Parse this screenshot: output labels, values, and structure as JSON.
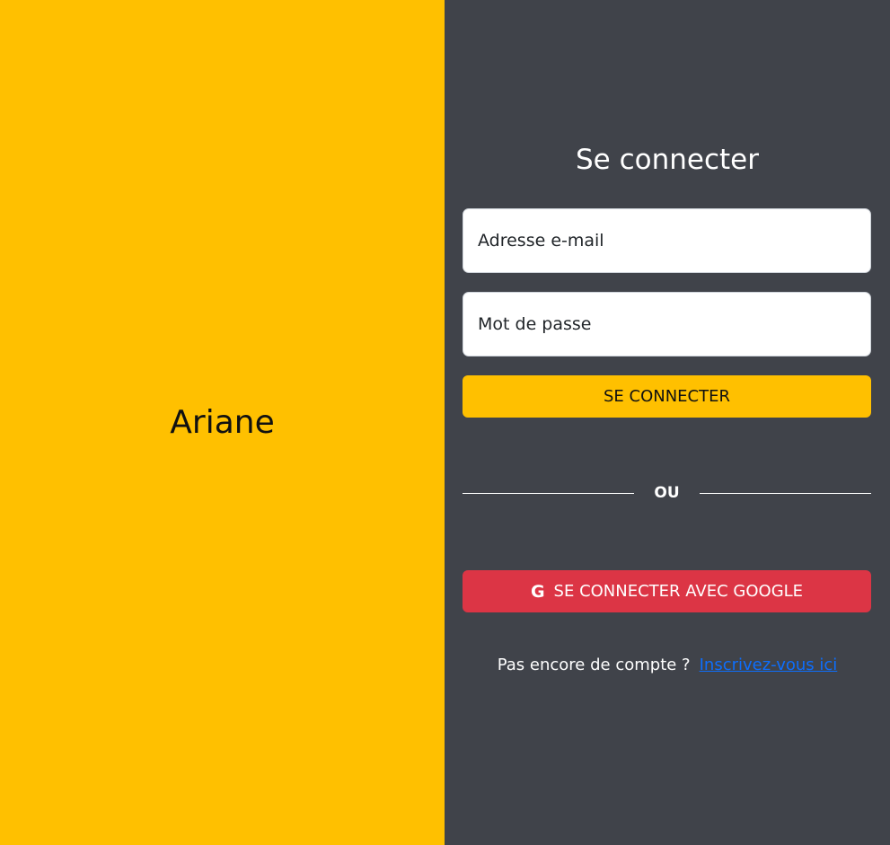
{
  "brand": {
    "name": "Ariane"
  },
  "login": {
    "title": "Se connecter",
    "email_placeholder": "Adresse e-mail",
    "password_placeholder": "Mot de passe",
    "submit_label": "SE CONNECTER",
    "divider_label": "OU",
    "google_label": "SE CONNECTER AVEC GOOGLE",
    "google_icon_glyph": "G",
    "signup_prompt": "Pas encore de compte ?",
    "signup_link": "Inscrivez-vous ici"
  },
  "colors": {
    "accent": "#ffc000",
    "panel": "#40434a",
    "google": "#dc3545",
    "link": "#0d6efd"
  },
  "icons": {
    "google": "google-icon"
  }
}
